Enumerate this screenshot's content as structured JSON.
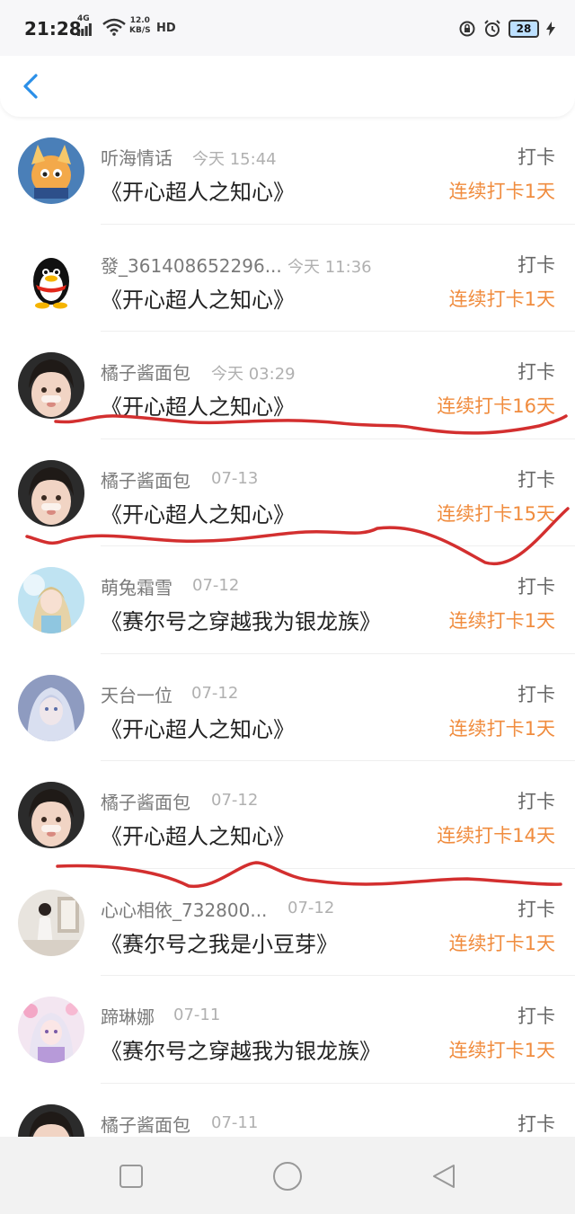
{
  "status_bar": {
    "time": "21:28",
    "network": "4G",
    "speed_value": "12.0",
    "speed_unit": "KB/S",
    "hd": "HD",
    "battery": "28"
  },
  "items": [
    {
      "name": "听海情话",
      "time": "今天 15:44",
      "book": "《开心超人之知心》",
      "action": "打卡",
      "streak": "连续打卡1天",
      "avatar": "cartoon-avatar"
    },
    {
      "name": "發_361408652296...",
      "time": "今天 11:36",
      "book": "《开心超人之知心》",
      "action": "打卡",
      "streak": "连续打卡1天",
      "avatar": "qq-penguin-avatar"
    },
    {
      "name": "橘子酱面包",
      "time": "今天 03:29",
      "book": "《开心超人之知心》",
      "action": "打卡",
      "streak": "连续打卡16天",
      "avatar": "child-photo-avatar"
    },
    {
      "name": "橘子酱面包",
      "time": "07-13",
      "book": "《开心超人之知心》",
      "action": "打卡",
      "streak": "连续打卡15天",
      "avatar": "child-photo-avatar"
    },
    {
      "name": "萌兔霜雪",
      "time": "07-12",
      "book": "《赛尔号之穿越我为银龙族》",
      "action": "打卡",
      "streak": "连续打卡1天",
      "avatar": "anime-girl-avatar"
    },
    {
      "name": "天台一位",
      "time": "07-12",
      "book": "《开心超人之知心》",
      "action": "打卡",
      "streak": "连续打卡1天",
      "avatar": "anime-silver-avatar"
    },
    {
      "name": "橘子酱面包",
      "time": "07-12",
      "book": "《开心超人之知心》",
      "action": "打卡",
      "streak": "连续打卡14天",
      "avatar": "child-photo-avatar"
    },
    {
      "name": "心心相依_732800...",
      "time": "07-12",
      "book": "《赛尔号之我是小豆芽》",
      "action": "打卡",
      "streak": "连续打卡1天",
      "avatar": "room-photo-avatar"
    },
    {
      "name": "蹄琳娜",
      "time": "07-11",
      "book": "《赛尔号之穿越我为银龙族》",
      "action": "打卡",
      "streak": "连续打卡1天",
      "avatar": "anime-pink-avatar"
    },
    {
      "name": "橘子酱面包",
      "time": "07-11",
      "book": "",
      "action": "打卡",
      "streak": "",
      "avatar": "child-photo-avatar"
    }
  ],
  "colors": {
    "accent": "#f08c3e",
    "back_arrow": "#2b8fe8",
    "scribble": "#d32f2f"
  }
}
